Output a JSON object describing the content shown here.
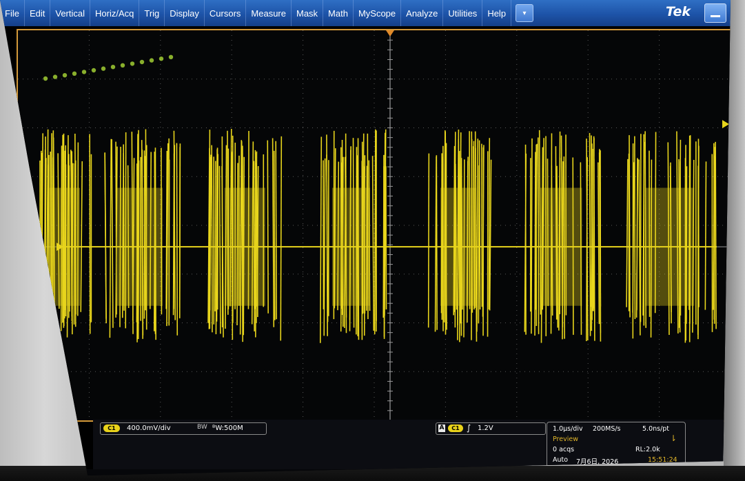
{
  "menu": {
    "items": [
      "File",
      "Edit",
      "Vertical",
      "Horiz/Acq",
      "Trig",
      "Display",
      "Cursors",
      "Measure",
      "Mask",
      "Math",
      "MyScope",
      "Analyze",
      "Utilities",
      "Help"
    ],
    "dropdown_icon": "▾",
    "brand": "Tek",
    "minimize_icon": "minimize-icon"
  },
  "colors": {
    "menubar": "#1d53a8",
    "trace": "#e8d51c",
    "graticule_border": "#d59a3a",
    "accent_text": "#e0b52a"
  },
  "channel": {
    "badge": "C1",
    "scale": "400.0mV/div",
    "bw_icon": "BW",
    "bw_limit": "ᴮW:500M"
  },
  "trigger": {
    "source_badge": "A",
    "channel_badge": "C1",
    "slope_icon": "rising-edge-icon",
    "level": "1.2V"
  },
  "acquisition": {
    "time_per_div": "1.0µs/div",
    "sample_rate": "200MS/s",
    "time_per_point": "5.0ns/pt",
    "state": "Preview",
    "acqs": "0 acqs",
    "record_length": "RL:2.0k",
    "mode": "Auto",
    "date": "7月6日, 2026",
    "time": "15:51:24",
    "trigger_icon": "trigger-arrow-icon"
  },
  "waveform": {
    "bursts": 7,
    "burst_period_div": 1.0,
    "burst_duty": 0.55,
    "offset_div": 0.0,
    "amplitude_div": 2.2
  }
}
